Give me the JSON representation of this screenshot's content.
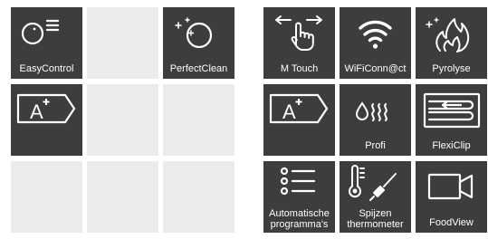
{
  "panel_left": {
    "tiles": [
      {
        "label": "EasyControl",
        "icon": "easy-control-icon"
      },
      {
        "label": "",
        "icon": null
      },
      {
        "label": "PerfectClean",
        "icon": "perfect-clean-icon"
      },
      {
        "label": "",
        "icon": "energy-class-a-plus-icon"
      },
      {
        "label": "",
        "icon": null
      },
      {
        "label": "",
        "icon": null
      },
      {
        "label": "",
        "icon": null
      },
      {
        "label": "",
        "icon": null
      },
      {
        "label": "",
        "icon": null
      }
    ]
  },
  "panel_right": {
    "tiles": [
      {
        "label": "M Touch",
        "icon": "m-touch-icon"
      },
      {
        "label": "WiFiConn@ct",
        "icon": "wifi-icon"
      },
      {
        "label": "Pyrolyse",
        "icon": "pyrolyse-flame-icon"
      },
      {
        "label": "",
        "icon": "energy-class-a-plus-icon"
      },
      {
        "label": "Profi",
        "icon": "profi-steam-icon"
      },
      {
        "label": "FlexiClip",
        "icon": "flexiclip-rails-icon"
      },
      {
        "label_line1": "Automatische",
        "label_line2": "programma's",
        "icon": "automatic-programs-icon"
      },
      {
        "label_line1": "Spijzen",
        "label_line2": "thermometer",
        "icon": "food-thermometer-icon"
      },
      {
        "label": "FoodView",
        "icon": "camera-icon"
      }
    ]
  },
  "energy_class": "A",
  "colors": {
    "tile": "#3d3d3d",
    "empty_tile": "#ebebeb",
    "icon": "#ffffff"
  }
}
